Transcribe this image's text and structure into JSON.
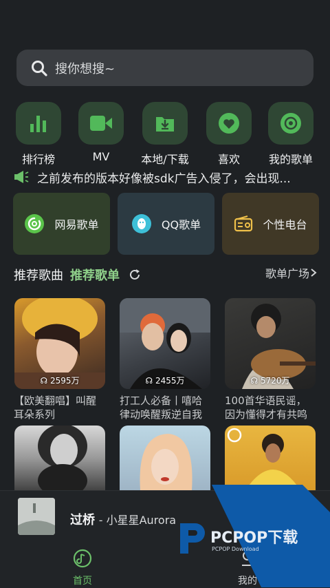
{
  "search": {
    "placeholder": "搜你想搜~"
  },
  "quick": [
    {
      "label": "排行榜",
      "icon": "chart-bars-icon"
    },
    {
      "label": "MV",
      "icon": "video-camera-icon"
    },
    {
      "label": "本地/下载",
      "icon": "folder-download-icon"
    },
    {
      "label": "喜欢",
      "icon": "heart-icon"
    },
    {
      "label": "我的歌单",
      "icon": "disc-icon"
    }
  ],
  "notice": {
    "text": "之前发布的版本好像被sdk广告入侵了，会出现..."
  },
  "platforms": [
    {
      "label": "网易歌单",
      "bg": "#31402b"
    },
    {
      "label": "QQ歌单",
      "bg": "#2c3a42"
    },
    {
      "label": "个性电台",
      "bg": "#403826"
    }
  ],
  "section": {
    "tab1": "推荐歌曲",
    "tab2": "推荐歌单",
    "more": "歌单广场"
  },
  "playlists": [
    {
      "plays": "2595万",
      "line1": "【欧美翻唱】叫醒",
      "line2": "耳朵系列"
    },
    {
      "plays": "2455万",
      "line1": "打工人必备丨嘻哈",
      "line2": "律动唤醒叛逆自我"
    },
    {
      "plays": "5720万",
      "line1": "100首华语民谣，",
      "line2": "因为懂得才有共鸣"
    }
  ],
  "player": {
    "cover_text": "过桥",
    "title": "过桥",
    "artist": "小星星Aurora"
  },
  "nav": {
    "home": "首页",
    "mine": "我的"
  },
  "watermark": {
    "brand": "PCPOP下载",
    "sub": "PCPOP Download"
  },
  "colors": {
    "accent": "#6cc06a",
    "green_icon": "#52b95a",
    "tab_active": "#8fd08a"
  }
}
